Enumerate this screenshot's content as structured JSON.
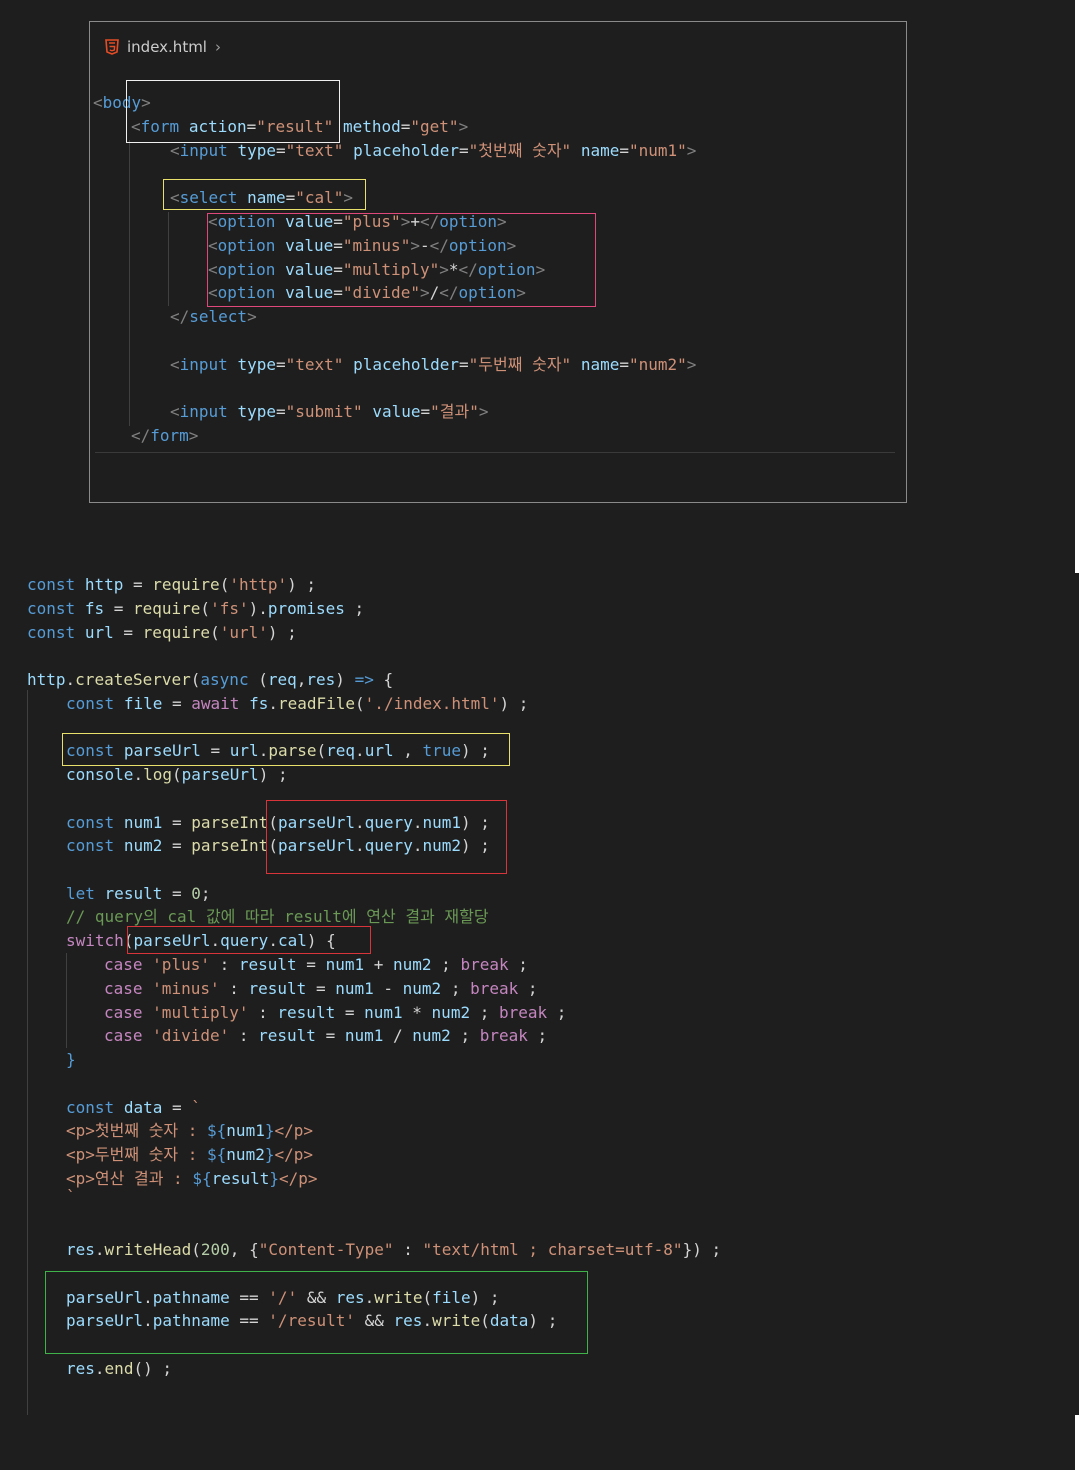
{
  "file_tab": {
    "filename": "index.html",
    "icon": "html5-icon",
    "chevron": "›"
  },
  "html_lines": [
    "<body>",
    "<form action=\"result\" method=\"get\">",
    "<input type=\"text\" placeholder=\"첫번째 숫자\" name=\"num1\">",
    "<select name=\"cal\">",
    "<option value=\"plus\">+</option>",
    "<option value=\"minus\">-</option>",
    "<option value=\"multiply\">*</option>",
    "<option value=\"divide\">/</option>",
    "</select>",
    "<input type=\"text\" placeholder=\"두번째 숫자\" name=\"num2\">",
    "<input type=\"submit\" value=\"결과\">",
    "</form>"
  ],
  "js_lines": [
    "const http = require('http') ;",
    "const fs = require('fs').promises ;",
    "const url = require('url') ;",
    "http.createServer(async (req,res) => {",
    "const file = await fs.readFile('./index.html') ;",
    "const parseUrl = url.parse(req.url , true) ;",
    "console.log(parseUrl) ;",
    "const num1 = parseInt(parseUrl.query.num1) ;",
    "const num2 = parseInt(parseUrl.query.num2) ;",
    "let result = 0;",
    "// query의 cal 값에 따라 result에 연산 결과 재할당",
    "switch(parseUrl.query.cal) {",
    "case 'plus' : result = num1 + num2 ; break ;",
    "case 'minus' : result = num1 - num2 ; break ;",
    "case 'multiply' : result = num1 * num2 ; break ;",
    "case 'divide' : result = num1 / num2 ; break ;",
    "}",
    "const data = `",
    "<p>첫번째 숫자 : ${num1}</p>",
    "<p>두번째 숫자 : ${num2}</p>",
    "<p>연산 결과 : ${result}</p>",
    "`",
    "res.writeHead(200, {\"Content-Type\" : \"text/html ; charset=utf-8\"}) ;",
    "parseUrl.pathname == '/' && res.write(file) ;",
    "parseUrl.pathname == '/result' && res.write(data) ;",
    "res.end() ;"
  ],
  "colors": {
    "background": "#1e1e1e",
    "box_white": "#f0f0f0",
    "box_yellow": "#e8e06a",
    "box_red_pink": "#e0477a",
    "box_red": "#d8343a",
    "box_green": "#3fb24a"
  }
}
